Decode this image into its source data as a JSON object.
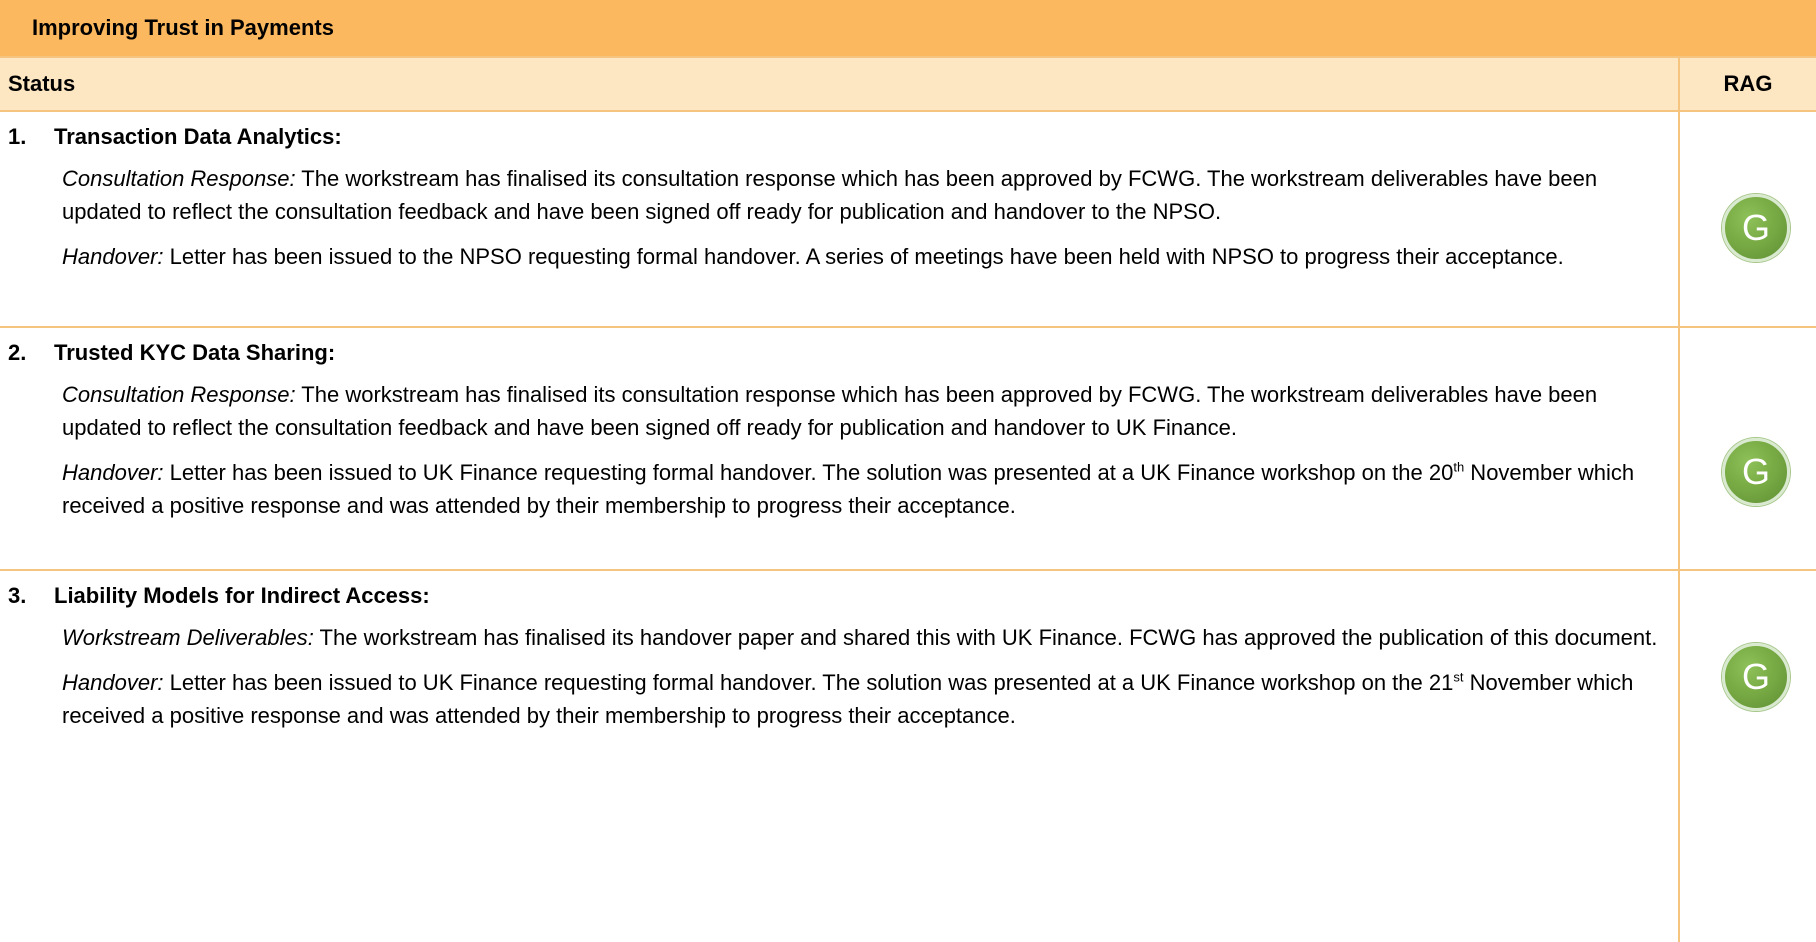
{
  "table": {
    "title": "Improving Trust in Payments",
    "header": {
      "status": "Status",
      "rag": "RAG"
    },
    "items": [
      {
        "number": "1.",
        "title": "Transaction Data Analytics:",
        "paragraphs": [
          {
            "lead": "Consultation Response:",
            "text": " The workstream has finalised its consultation response which has been approved by FCWG. The workstream deliverables have been updated to reflect the consultation feedback and have been signed off ready for publication and handover to the NPSO."
          },
          {
            "lead": "Handover:",
            "text": " Letter has been issued to the NPSO requesting formal handover. A series of meetings have been held with NPSO to progress their acceptance."
          }
        ],
        "rag": "G",
        "rag_color": "#79ab45"
      },
      {
        "number": "2.",
        "title": "Trusted KYC Data Sharing:",
        "paragraphs": [
          {
            "lead": "Consultation Response:",
            "text": " The workstream has finalised its consultation response which has been approved by FCWG. The workstream deliverables have been updated to reflect the consultation feedback and have been signed off ready for publication and handover to UK Finance."
          },
          {
            "lead": "Handover:",
            "text_before": " Letter has been issued to UK Finance requesting formal handover. The solution was presented at a UK Finance workshop on the 20",
            "sup": "th",
            "text_after": " November which received a positive response and was attended by their membership to progress their acceptance."
          }
        ],
        "rag": "G",
        "rag_color": "#79ab45"
      },
      {
        "number": "3.",
        "title": "Liability Models for Indirect Access:",
        "paragraphs": [
          {
            "lead": "Workstream Deliverables:",
            "text": " The workstream has finalised its handover paper and shared this with UK Finance. FCWG has approved the publication of this document."
          },
          {
            "lead": "Handover:",
            "text_before": " Letter has been issued to UK Finance requesting formal handover. The solution was presented at a UK Finance workshop on the 21",
            "sup": "st",
            "text_after": " November which received a positive response and was attended by their membership to progress their acceptance."
          }
        ],
        "rag": "G",
        "rag_color": "#79ab45"
      }
    ]
  },
  "colors": {
    "title_bg": "#fbb85f",
    "header_bg": "#fde6c2",
    "border": "#f5c47f"
  }
}
